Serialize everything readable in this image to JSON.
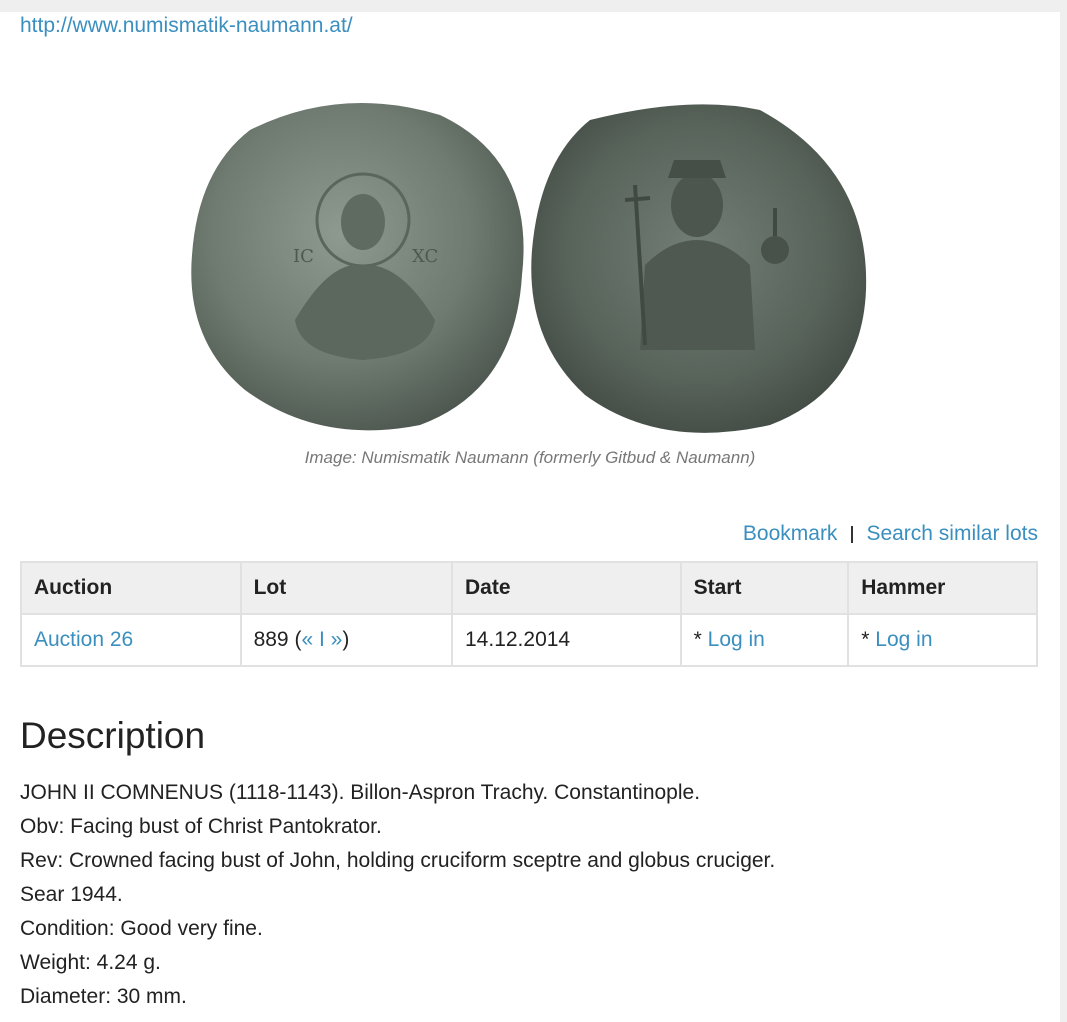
{
  "site_link": "http://www.numismatik-naumann.at/",
  "image_caption": "Image: Numismatik Naumann (formerly Gitbud & Naumann)",
  "actions": {
    "bookmark": "Bookmark",
    "search_similar": "Search similar lots"
  },
  "lot_table": {
    "headers": [
      "Auction",
      "Lot",
      "Date",
      "Start",
      "Hammer"
    ],
    "row": {
      "auction": "Auction 26",
      "lot_number": "889",
      "lot_open": "(",
      "prev": "«",
      "divider": "I",
      "next": "»",
      "lot_close": ")",
      "date": "14.12.2014",
      "start_prefix": "* ",
      "start_link": "Log in",
      "hammer_prefix": "* ",
      "hammer_link": "Log in"
    }
  },
  "description": {
    "title": "Description",
    "lines": [
      "JOHN II COMNENUS (1118-1143). Billon-Aspron Trachy. Constantinople.",
      "Obv: Facing bust of Christ Pantokrator.",
      "Rev: Crowned facing bust of John, holding cruciform sceptre and globus cruciger.",
      "Sear 1944.",
      "Condition: Good very fine.",
      "Weight: 4.24 g.",
      "Diameter: 30 mm."
    ]
  },
  "colors": {
    "link": "#3a8fbf",
    "table_header_bg": "#efefef",
    "table_border": "#e1e1e1",
    "caption": "#777777"
  }
}
